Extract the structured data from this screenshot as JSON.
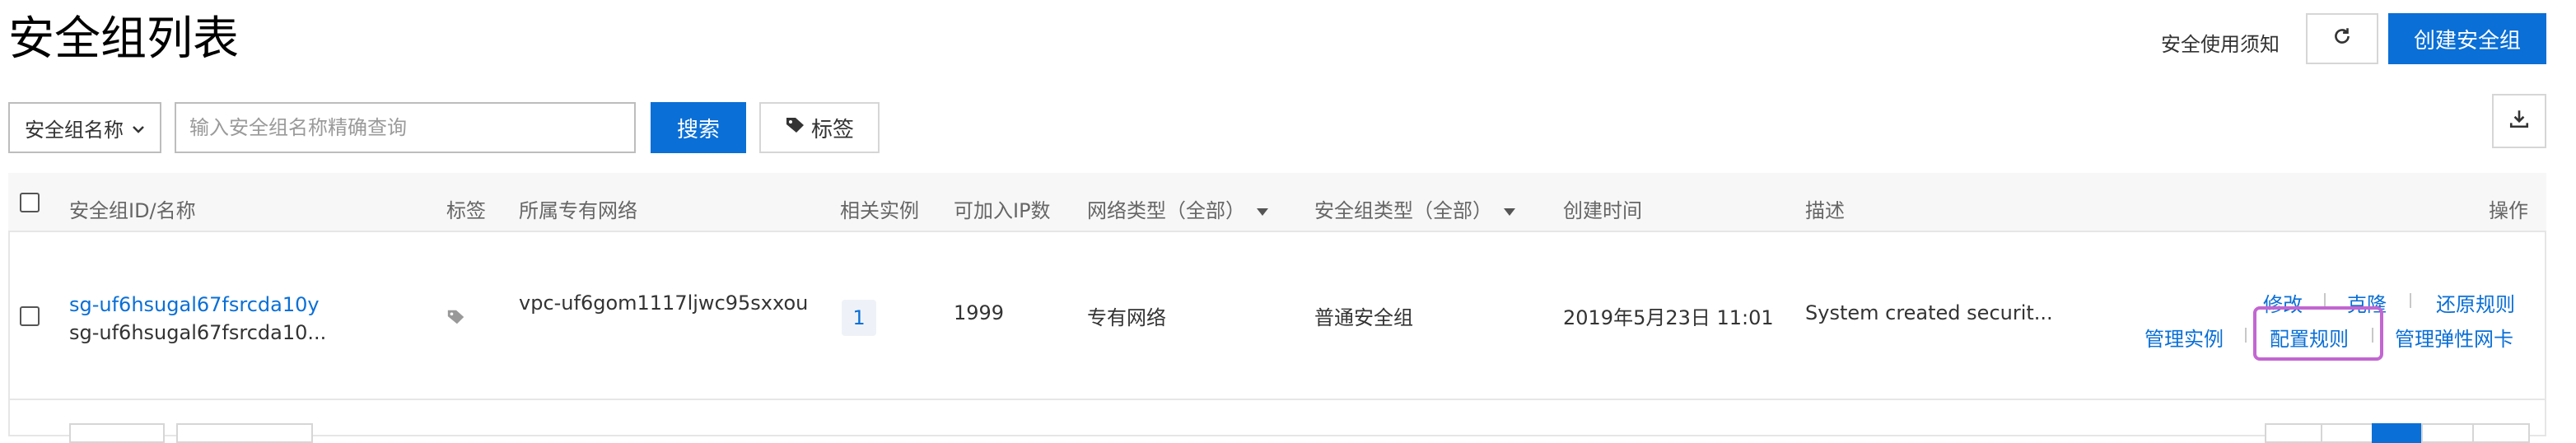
{
  "page": {
    "title": "安全组列表",
    "notice_link": "安全使用须知",
    "refresh_icon": "refresh-icon",
    "create_button": "创建安全组",
    "download_icon": "download-icon"
  },
  "search": {
    "field_select": "安全组名称",
    "placeholder": "输入安全组名称精确查询",
    "search_button": "搜索",
    "tag_button": "标签"
  },
  "table": {
    "columns": [
      "安全组ID/名称",
      "标签",
      "所属专有网络",
      "相关实例",
      "可加入IP数",
      "网络类型（全部）",
      "安全组类型（全部）",
      "创建时间",
      "描述",
      "操作"
    ],
    "rows": [
      {
        "id": "sg-uf6hsugal67fsrcda10y",
        "name": "sg-uf6hsugal67fsrcda10...",
        "tag_icon": "tag-icon",
        "vpc": "vpc-uf6gom1117ljwc95sxxou",
        "instances": "1",
        "ip_count": "1999",
        "network_type": "专有网络",
        "sg_type": "普通安全组",
        "created": "2019年5月23日 11:01",
        "description": "System created securit...",
        "actions": {
          "modify": "修改",
          "clone": "克隆",
          "restore": "还原规则",
          "manage_instances": "管理实例",
          "configure_rules": "配置规则",
          "manage_eni": "管理弹性网卡"
        }
      }
    ]
  },
  "colors": {
    "primary": "#0a6fd6",
    "highlight": "#c266d1"
  }
}
